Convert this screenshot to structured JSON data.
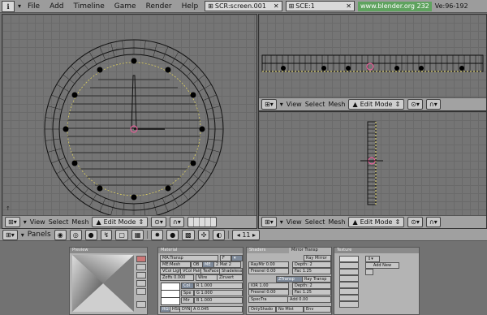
{
  "top_menu": {
    "info_icon": "i",
    "items": [
      "File",
      "Add",
      "Timeline",
      "Game",
      "Render",
      "Help"
    ],
    "screen_field": "SCR:screen.001",
    "scene_field": "SCE:1",
    "url": "www.blender.org 232",
    "stats": "Ve:96-192"
  },
  "viewport_header": {
    "menus": [
      "View",
      "Select",
      "Mesh"
    ],
    "mode": "Edit Mode"
  },
  "buttons_header": {
    "panels_label": "Panels",
    "frame": "11"
  },
  "preview_panel": {
    "title": "Preview"
  },
  "material_panel": {
    "title": "Material",
    "name": "MA:Transp",
    "me_label": "ME:Mesh",
    "ob_label": "OB",
    "me_btn": "ME",
    "mat_count": "2 Mat 2",
    "vcol_light": "VCol Light",
    "vcol_paint": "VCol Paint",
    "texface": "TexFace",
    "shadeless": "Shadeless",
    "zoffs": "Zoffs 0.000",
    "wire": "Wire",
    "ztransp": "ZInvert",
    "col": "Col",
    "spe": "Spe",
    "mir": "Mir",
    "r1": "R 1.000",
    "g1": "G 1.000",
    "b1": "B 1.000",
    "rgb": "RGB",
    "hsv": "HSV",
    "dyn": "DYN",
    "alpha": "A 0.045"
  },
  "shaders_panel": {
    "tab1": "Shaders",
    "tab2": "Mirror Transp",
    "ray_mirror": "Ray Mirror",
    "raymir": "RayMir 0.00",
    "depth1": "Depth: 2",
    "fresnel1": "Fresnel 0.00",
    "fac1": "Fac 1.25",
    "ztransp": "ZTransp",
    "ray_transp": "Ray Transp",
    "ior": "IOR 1.00",
    "depth2": "Depth: 2",
    "fresnel2": "Fresnel 0.00",
    "fac2": "Fac 1.25",
    "spectra": "SpecTra",
    "add": "Add 0.00",
    "onlyshadow": "OnlyShado",
    "nomist": "No Mist",
    "env": "Env"
  },
  "texture_panel": {
    "title": "Texture",
    "add_new": "Add New"
  },
  "colors": {
    "background": "#737373",
    "header": "#a0a0a0",
    "mesh_edge": "#111111",
    "mesh_vertex": "#000000",
    "selection": "#ffb0ff",
    "green": "#5fa35f"
  }
}
